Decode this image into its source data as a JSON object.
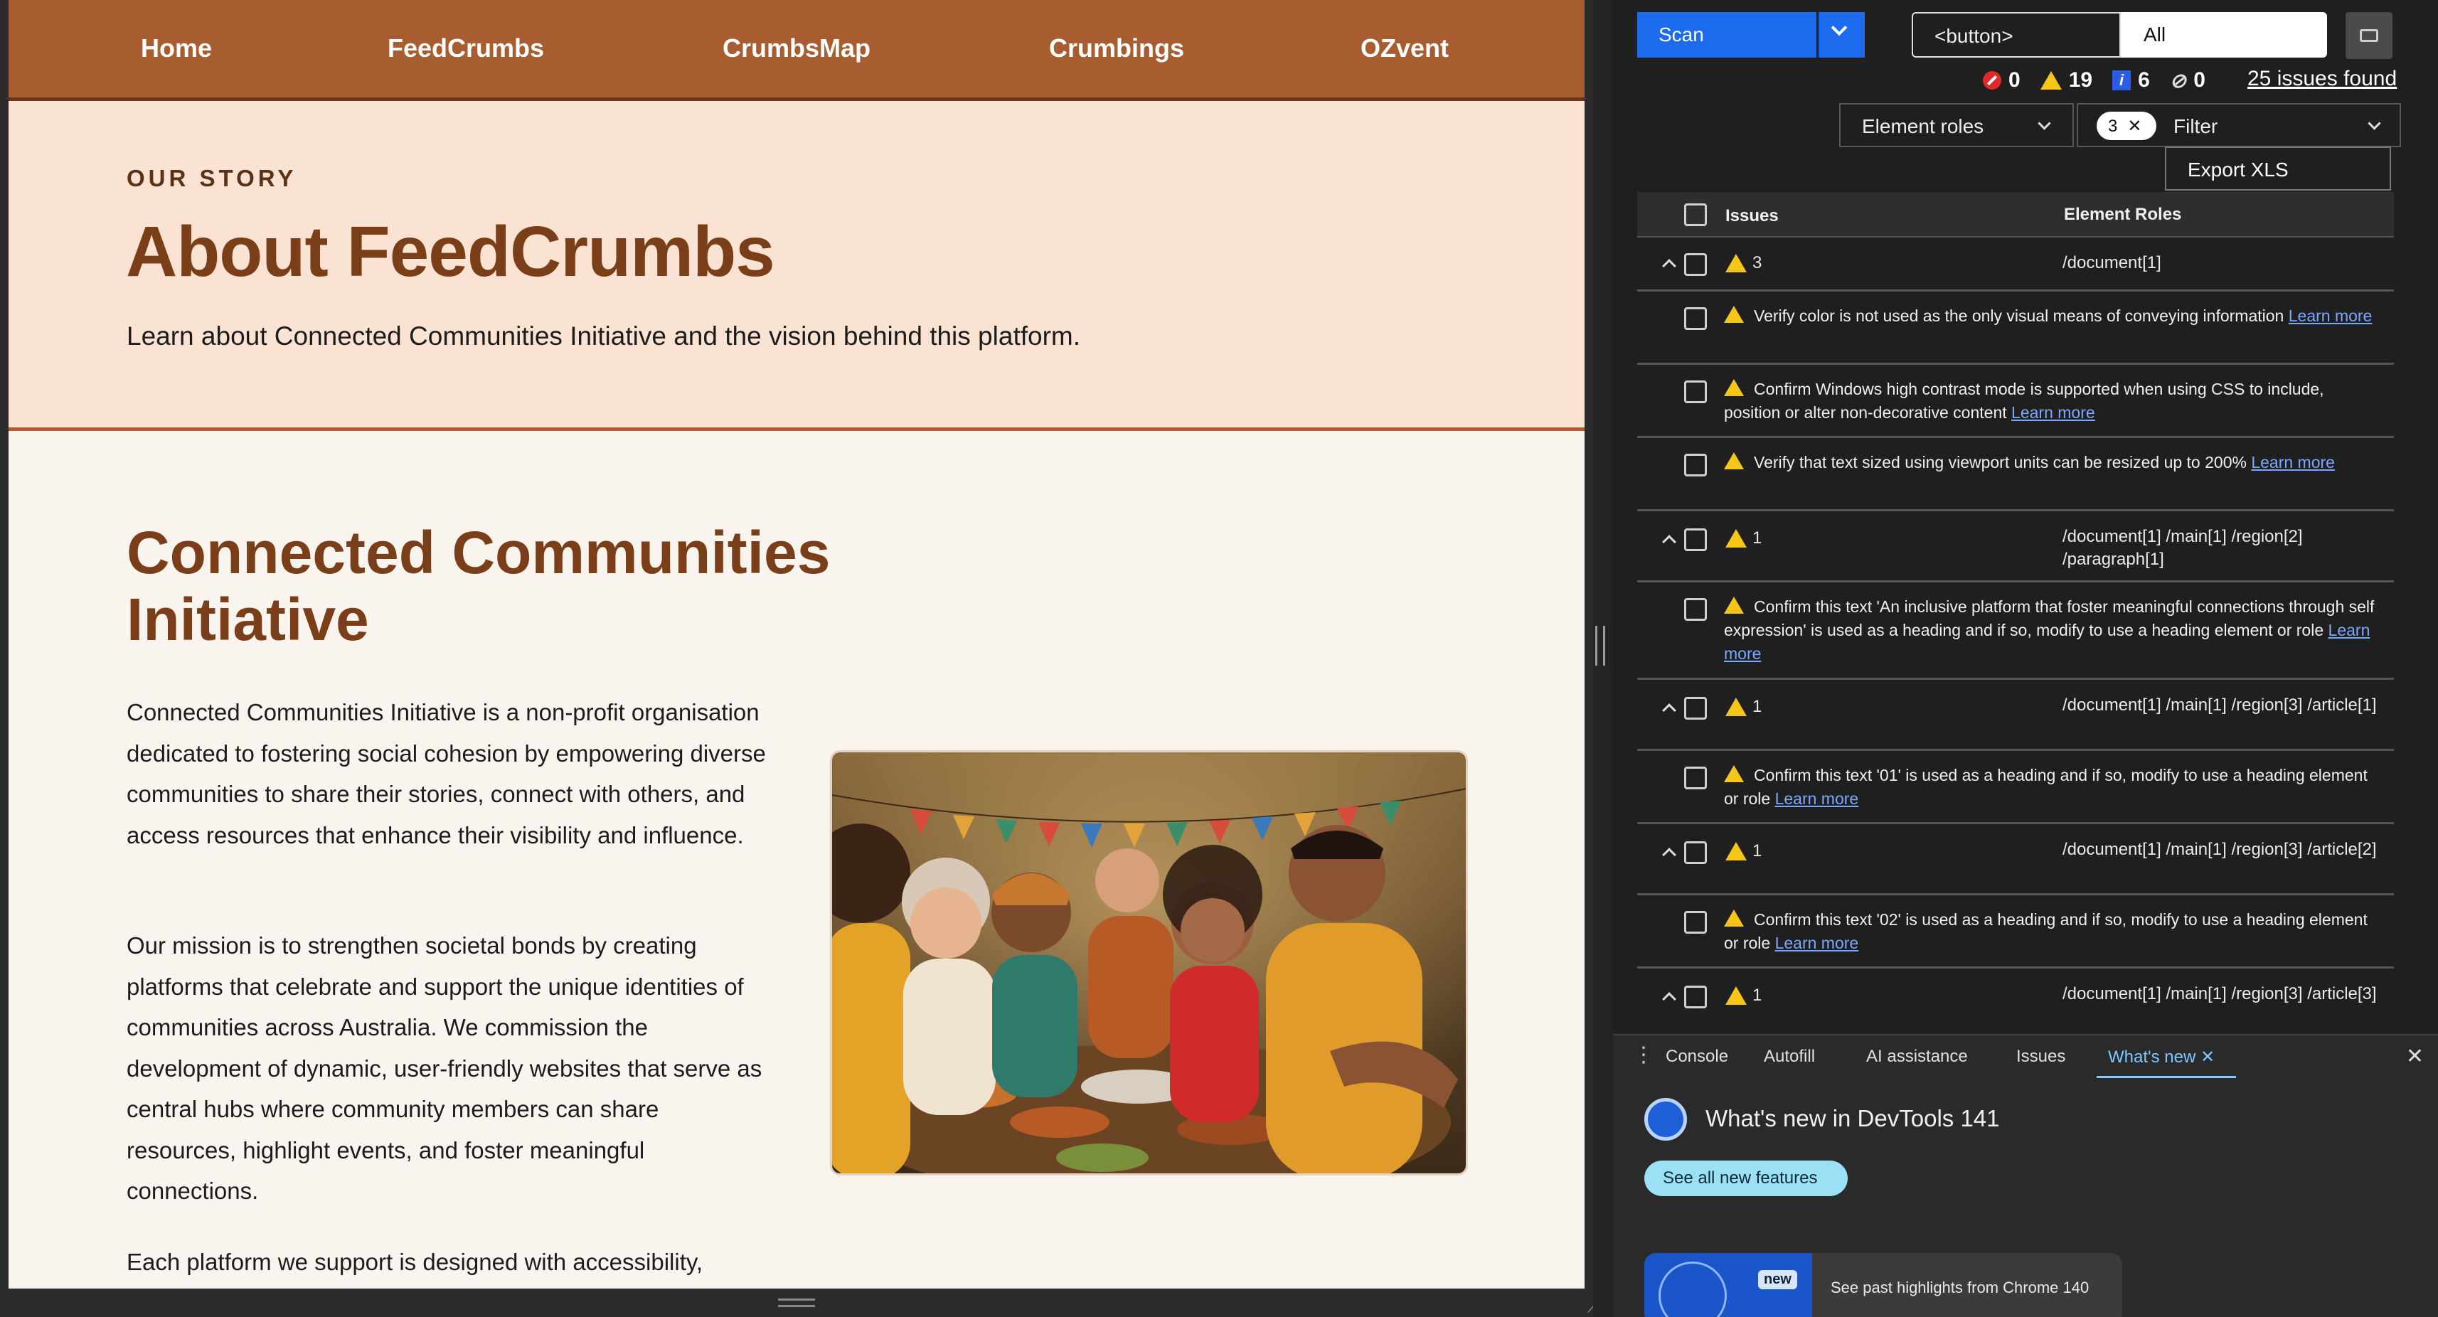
{
  "site": {
    "nav": [
      "Home",
      "FeedCrumbs",
      "CrumbsMap",
      "Crumbings",
      "OZvent"
    ],
    "eyebrow": "OUR STORY",
    "title": "About FeedCrumbs",
    "subtitle": "Learn about Connected Communities Initiative and the vision behind this platform.",
    "section_title": "Connected Communities Initiative",
    "paragraphs": [
      "Connected Communities Initiative is a non-profit organisation dedicated to fostering social cohesion by empowering diverse communities to share their stories, connect with others, and access resources that enhance their visibility and influence.",
      "Our mission is to strengthen societal bonds by creating platforms that celebrate and support the unique identities of communities across Australia. We commission the development of dynamic, user-friendly websites that serve as central hubs where community members can share resources, highlight events, and foster meaningful connections.",
      "Each platform we support is designed with accessibility,"
    ]
  },
  "devtools": {
    "scan_label": "Scan",
    "selector_value": "<button>",
    "scope_value": "All",
    "counts": {
      "errors": "0",
      "warnings": "19",
      "info": "6",
      "hidden": "0"
    },
    "issues_found": "25 issues found",
    "roles_dropdown": "Element roles",
    "filter_chip": "3",
    "filter_label": "Filter",
    "export_label": "Export XLS",
    "table_headers": {
      "issues": "Issues",
      "roles": "Element Roles"
    },
    "learn_more": "Learn more",
    "groups": [
      {
        "count": "3",
        "path": "/document[1]"
      },
      {
        "count": "1",
        "path": "/document[1] /main[1] /region[2] /paragraph[1]"
      },
      {
        "count": "1",
        "path": "/document[1] /main[1] /region[3] /article[1]"
      },
      {
        "count": "1",
        "path": "/document[1] /main[1] /region[3] /article[2]"
      },
      {
        "count": "1",
        "path": "/document[1] /main[1] /region[3] /article[3]"
      }
    ],
    "issues": [
      "Verify color is not used as the only visual means of conveying information",
      "Confirm Windows high contrast mode is supported when using CSS to include, position or alter non-decorative content",
      "Verify that text sized using viewport units can be resized up to 200%",
      "Confirm this text 'An inclusive platform that foster meaningful connections through self expression' is used as a heading and if so, modify to use a heading element or role",
      "Confirm this text '01' is used as a heading and if so, modify to use a heading element or role",
      "Confirm this text '02' is used as a heading and if so, modify to use a heading element or role"
    ],
    "drawer": {
      "tabs": [
        "Console",
        "Autofill",
        "AI assistance",
        "Issues",
        "What's new"
      ],
      "title": "What's new in DevTools 141",
      "button": "See all new features",
      "badge": "new",
      "card_text": "See past highlights from Chrome 140"
    }
  }
}
